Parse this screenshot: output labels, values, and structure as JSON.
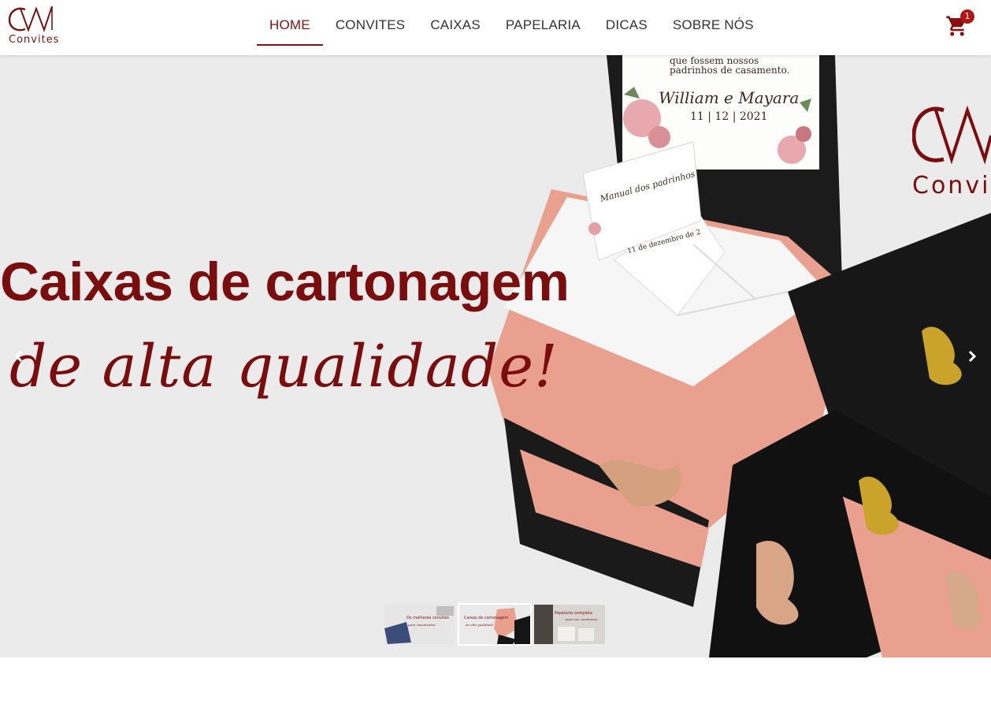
{
  "header": {
    "logo_text": "Convites",
    "nav": [
      {
        "label": "HOME",
        "active": true
      },
      {
        "label": "CONVITES",
        "active": false
      },
      {
        "label": "CAIXAS",
        "active": false
      },
      {
        "label": "PAPELARIA",
        "active": false
      },
      {
        "label": "DICAS",
        "active": false
      },
      {
        "label": "SOBRE NÓS",
        "active": false
      }
    ],
    "cart_count": "1"
  },
  "slider": {
    "title": "Caixas de cartonagem",
    "subtitle_script": "de alta qualidade!",
    "brand_text": "Convit",
    "card": {
      "line1": "que fossem nossos",
      "line2": "padrinhos de casamento.",
      "names": "William e Mayara",
      "date": "11 | 12 | 2021",
      "manual_title": "Manual dos padrinhos",
      "manual_date": "11 de dezembro de 2"
    },
    "thumbnails": [
      {
        "caption": "Os melhores convites",
        "sub": "para casamentos",
        "active": false
      },
      {
        "caption": "Caixas de cartonagem",
        "sub": "de alta qualidade",
        "active": true
      },
      {
        "caption": "Papelaria completa",
        "sub": "para seu casamento",
        "active": false
      }
    ]
  },
  "colors": {
    "accent": "#8b0d0d",
    "slider_bg": "#ebebeb",
    "badge": "#b31414"
  }
}
